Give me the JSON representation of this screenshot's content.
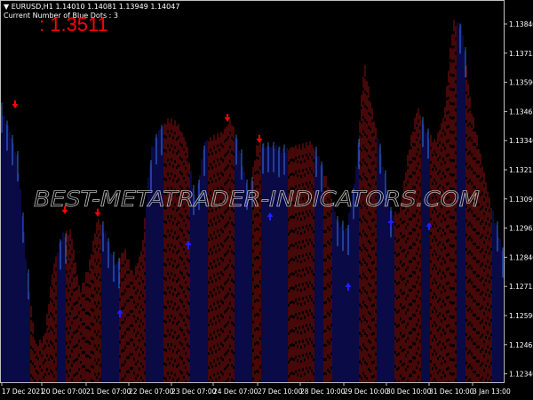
{
  "header": {
    "symbol_line": "EURUSD,H1  1.14010 1.14081 1.13949 1.14047",
    "blue_dots_label": "Current Number of Blue Dots :",
    "blue_dots_count": "3",
    "indicator_value": ": 1.3511"
  },
  "watermark": "BEST-METATRADER-INDICATORS.COM",
  "colors": {
    "bull": "#14148c",
    "bear": "#8c1010",
    "bull_line": "#2a6aa8",
    "arrow_down": "#ff0000",
    "arrow_up": "#2020ff",
    "axis": "#c0c0c0"
  },
  "chart_data": {
    "type": "bar",
    "title": "EURUSD,H1",
    "ylim": [
      1.1228,
      1.1391
    ],
    "y_ticks": [
      "1.13840",
      "1.13715",
      "1.13590",
      "1.13465",
      "1.13340",
      "1.13215",
      "1.13090",
      "1.12965",
      "1.12840",
      "1.12715",
      "1.12590",
      "1.12465",
      "1.12340"
    ],
    "x_ticks": [
      "17 Dec 2021",
      "20 Dec 07:00",
      "21 Dec 07:00",
      "22 Dec 07:00",
      "23 Dec 07:00",
      "24 Dec 07:00",
      "27 Dec 10:00",
      "28 Dec 10:00",
      "29 Dec 10:00",
      "30 Dec 10:00",
      "31 Dec 10:00",
      "3 Jan 13:00"
    ],
    "prices": [
      1.13486,
      1.1339,
      1.13257,
      1.128,
      1.12457,
      1.12495,
      1.128,
      1.12933,
      1.12952,
      1.12686,
      1.128,
      1.13009,
      1.12933,
      1.128,
      1.12876,
      1.12762,
      1.12876,
      1.13295,
      1.1339,
      1.13429,
      1.1341,
      1.13333,
      1.13067,
      1.13333,
      1.13352,
      1.13371,
      1.13429,
      1.13295,
      1.13105,
      1.13333,
      1.13314,
      1.13314,
      1.13295,
      1.13314,
      1.13314,
      1.13333,
      1.13257,
      1.13143,
      1.1299,
      1.12952,
      1.13181,
      1.13676,
      1.13448,
      1.13257,
      1.13029,
      1.13029,
      1.13295,
      1.13486,
      1.13371,
      1.13333,
      1.13448,
      1.13848,
      1.13829,
      1.13486,
      1.13295,
      1.13105,
      1.12952
    ],
    "regime": [
      "bull",
      "bull",
      "bull",
      "bull",
      "bear",
      "bear",
      "bear",
      "bull",
      "bear",
      "bear",
      "bear",
      "bear",
      "bull",
      "bull",
      "bear",
      "bear",
      "bear",
      "bull",
      "bull",
      "bear",
      "bear",
      "bear",
      "bull",
      "bull",
      "bear",
      "bear",
      "bear",
      "bull",
      "bull",
      "bear",
      "bull",
      "bull",
      "bull",
      "bear",
      "bear",
      "bear",
      "bull",
      "bear",
      "bull",
      "bull",
      "bull",
      "bear",
      "bear",
      "bull",
      "bull",
      "bear",
      "bear",
      "bear",
      "bull",
      "bear",
      "bear",
      "bear",
      "bull",
      "bear",
      "bear",
      "bear",
      "bull"
    ],
    "sell_arrows": [
      {
        "i": 1.7,
        "price": 1.13493
      },
      {
        "i": 7.3,
        "price": 1.1304
      },
      {
        "i": 11,
        "price": 1.13029
      },
      {
        "i": 25.6,
        "price": 1.13436
      },
      {
        "i": 29.2,
        "price": 1.13345
      }
    ],
    "buy_arrows": [
      {
        "i": 13.5,
        "price": 1.12602
      },
      {
        "i": 21.2,
        "price": 1.12895
      },
      {
        "i": 30.4,
        "price": 1.13017
      },
      {
        "i": 39.2,
        "price": 1.12716
      },
      {
        "i": 44,
        "price": 1.1299
      },
      {
        "i": 48.3,
        "price": 1.12975
      }
    ]
  }
}
